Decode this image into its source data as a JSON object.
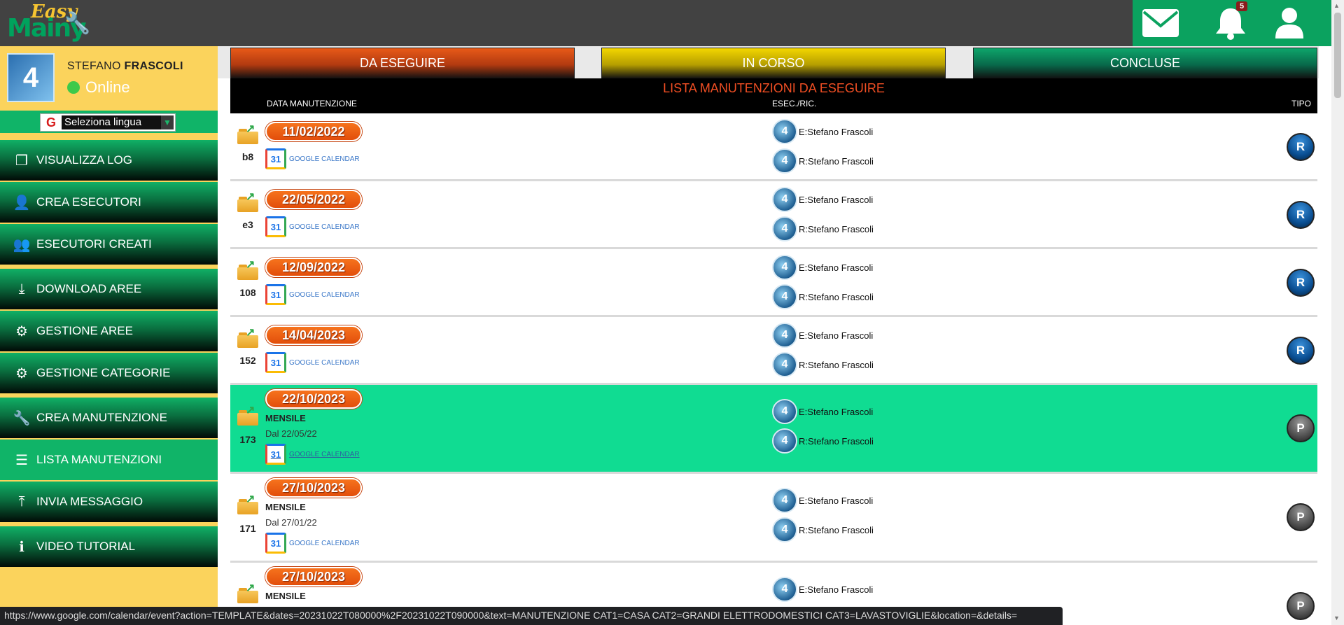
{
  "header": {
    "logo_easy": "Easy",
    "logo_main": "Mainy",
    "notifications_count": "5"
  },
  "profile": {
    "first_name": "STEFANO",
    "last_name": "FRASCOLI",
    "status": "Online"
  },
  "language": {
    "selected": "Seleziona lingua"
  },
  "sidebar": {
    "items": [
      {
        "label": "VISUALIZZA LOG",
        "icon": "file-copy-icon"
      },
      {
        "label": "CREA ESECUTORI",
        "icon": "user-icon"
      },
      {
        "label": "ESECUTORI CREATI",
        "icon": "users-icon"
      },
      {
        "label": "DOWNLOAD AREE",
        "icon": "download-icon"
      },
      {
        "label": "GESTIONE AREE",
        "icon": "cogs-icon"
      },
      {
        "label": "GESTIONE CATEGORIE",
        "icon": "cogs-icon"
      },
      {
        "label": "CREA MANUTENZIONE",
        "icon": "wrench-icon"
      },
      {
        "label": "LISTA MANUTENZIONI",
        "icon": "list-icon"
      },
      {
        "label": "INVIA MESSAGGIO",
        "icon": "upload-icon"
      },
      {
        "label": "VIDEO TUTORIAL",
        "icon": "info-icon"
      }
    ]
  },
  "tabs": {
    "todo": "DA ESEGUIRE",
    "progress": "IN CORSO",
    "done": "CONCLUSE"
  },
  "list": {
    "title": "LISTA MANUTENZIONI DA ESEGUIRE",
    "col_date": "DATA MANUTENZIONE",
    "col_exec": "ESEC./RIC.",
    "col_type": "TIPO",
    "gcal_label": "GOOGLE CALENDAR",
    "rows": [
      {
        "id": "b8",
        "date": "11/02/2022",
        "executor": "E:Stefano Frascoli",
        "receiver": "R:Stefano Frascoli",
        "type": "R"
      },
      {
        "id": "e3",
        "date": "22/05/2022",
        "executor": "E:Stefano Frascoli",
        "receiver": "R:Stefano Frascoli",
        "type": "R"
      },
      {
        "id": "108",
        "date": "12/09/2022",
        "executor": "E:Stefano Frascoli",
        "receiver": "R:Stefano Frascoli",
        "type": "R"
      },
      {
        "id": "152",
        "date": "14/04/2023",
        "executor": "E:Stefano Frascoli",
        "receiver": "R:Stefano Frascoli",
        "type": "R"
      },
      {
        "id": "173",
        "date": "22/10/2023",
        "frequency": "MENSILE",
        "since": "Dal 22/05/22",
        "executor": "E:Stefano Frascoli",
        "receiver": "R:Stefano Frascoli",
        "type": "P"
      },
      {
        "id": "171",
        "date": "27/10/2023",
        "frequency": "MENSILE",
        "since": "Dal 27/01/22",
        "executor": "E:Stefano Frascoli",
        "receiver": "R:Stefano Frascoli",
        "type": "P"
      },
      {
        "id": "",
        "date": "27/10/2023",
        "frequency": "MENSILE",
        "executor": "E:Stefano Frascoli",
        "type": "P"
      }
    ]
  },
  "status_bar": {
    "url": "https://www.google.com/calendar/event?action=TEMPLATE&dates=20231022T080000%2F20231022T090000&text=MANUTENZIONE CAT1=CASA CAT2=GRANDI ELETTRODOMESTICI CAT3=LAVASTOVIGLIE&location=&details="
  },
  "colors": {
    "header_bg": "#424242",
    "accent_green": "#10b468",
    "sidebar_yellow": "#fbd35c",
    "tab_orange": "#e85a18",
    "tab_yellow": "#f3d600",
    "tab_green": "#0ea56b",
    "highlight_row": "#10dc92"
  }
}
